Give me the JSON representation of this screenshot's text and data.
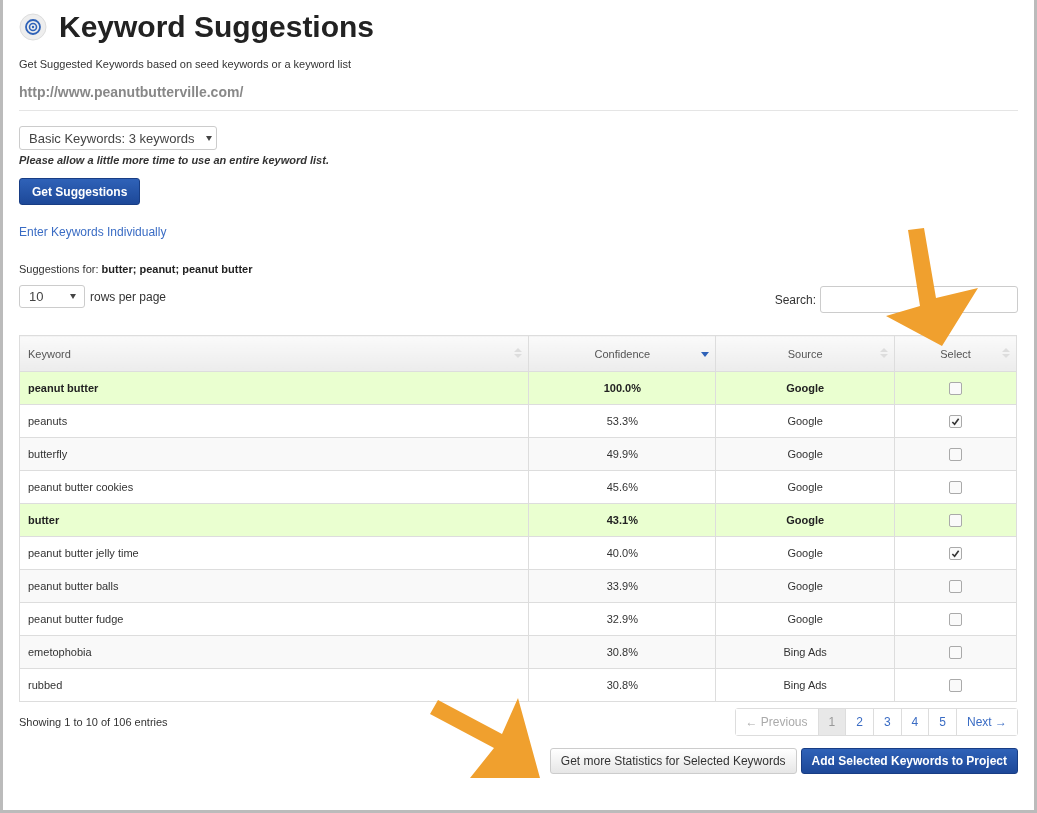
{
  "header": {
    "title": "Keyword Suggestions",
    "subtitle": "Get Suggested Keywords based on seed keywords or a keyword list",
    "url": "http://www.peanutbutterville.com/"
  },
  "keyword_list_select": {
    "value": "Basic Keywords: 3 keywords"
  },
  "note": "Please allow a little more time to use an entire keyword list.",
  "get_suggestions_button": "Get Suggestions",
  "enter_individually_link": "Enter Keywords Individually",
  "suggestions_for": "Suggestions for: **butter; peanut; peanut butter**",
  "rows_per_page": {
    "value": "10",
    "label": "rows per page"
  },
  "search": {
    "label": "Search:"
  },
  "table": {
    "columns": [
      {
        "label": "Keyword",
        "sorted": false
      },
      {
        "label": "Confidence",
        "sorted": true
      },
      {
        "label": "Source",
        "sorted": false
      },
      {
        "label": "Select",
        "sorted": false
      }
    ],
    "rows": [
      {
        "keyword": "peanut butter",
        "confidence": "100.0%",
        "source": "Google",
        "highlighted": true,
        "checked": false
      },
      {
        "keyword": "peanuts",
        "confidence": "53.3%",
        "source": "Google",
        "highlighted": false,
        "checked": true
      },
      {
        "keyword": "butterfly",
        "confidence": "49.9%",
        "source": "Google",
        "highlighted": false,
        "checked": false
      },
      {
        "keyword": "peanut butter cookies",
        "confidence": "45.6%",
        "source": "Google",
        "highlighted": false,
        "checked": false
      },
      {
        "keyword": "butter",
        "confidence": "43.1%",
        "source": "Google",
        "highlighted": true,
        "checked": false
      },
      {
        "keyword": "peanut butter jelly time",
        "confidence": "40.0%",
        "source": "Google",
        "highlighted": false,
        "checked": true
      },
      {
        "keyword": "peanut butter balls",
        "confidence": "33.9%",
        "source": "Google",
        "highlighted": false,
        "checked": false
      },
      {
        "keyword": "peanut butter fudge",
        "confidence": "32.9%",
        "source": "Google",
        "highlighted": false,
        "checked": false
      },
      {
        "keyword": "emetophobia",
        "confidence": "30.8%",
        "source": "Bing Ads",
        "highlighted": false,
        "checked": false
      },
      {
        "keyword": "rubbed",
        "confidence": "30.8%",
        "source": "Bing Ads",
        "highlighted": false,
        "checked": false
      }
    ]
  },
  "entries_info": "Showing 1 to 10 of 106 entries",
  "pagination": [
    {
      "label": "← Previous",
      "disabled": true,
      "selected": false
    },
    {
      "label": "1",
      "disabled": false,
      "selected": true
    },
    {
      "label": "2",
      "disabled": false,
      "selected": false
    },
    {
      "label": "3",
      "disabled": false,
      "selected": false
    },
    {
      "label": "4",
      "disabled": false,
      "selected": false
    },
    {
      "label": "5",
      "disabled": false,
      "selected": false
    },
    {
      "label": "Next →",
      "disabled": false,
      "selected": false
    }
  ],
  "actions": [
    {
      "label": "Get more Statistics for Selected Keywords",
      "kind": "default"
    },
    {
      "label": "Add Selected Keywords to Project",
      "kind": "primary"
    }
  ]
}
